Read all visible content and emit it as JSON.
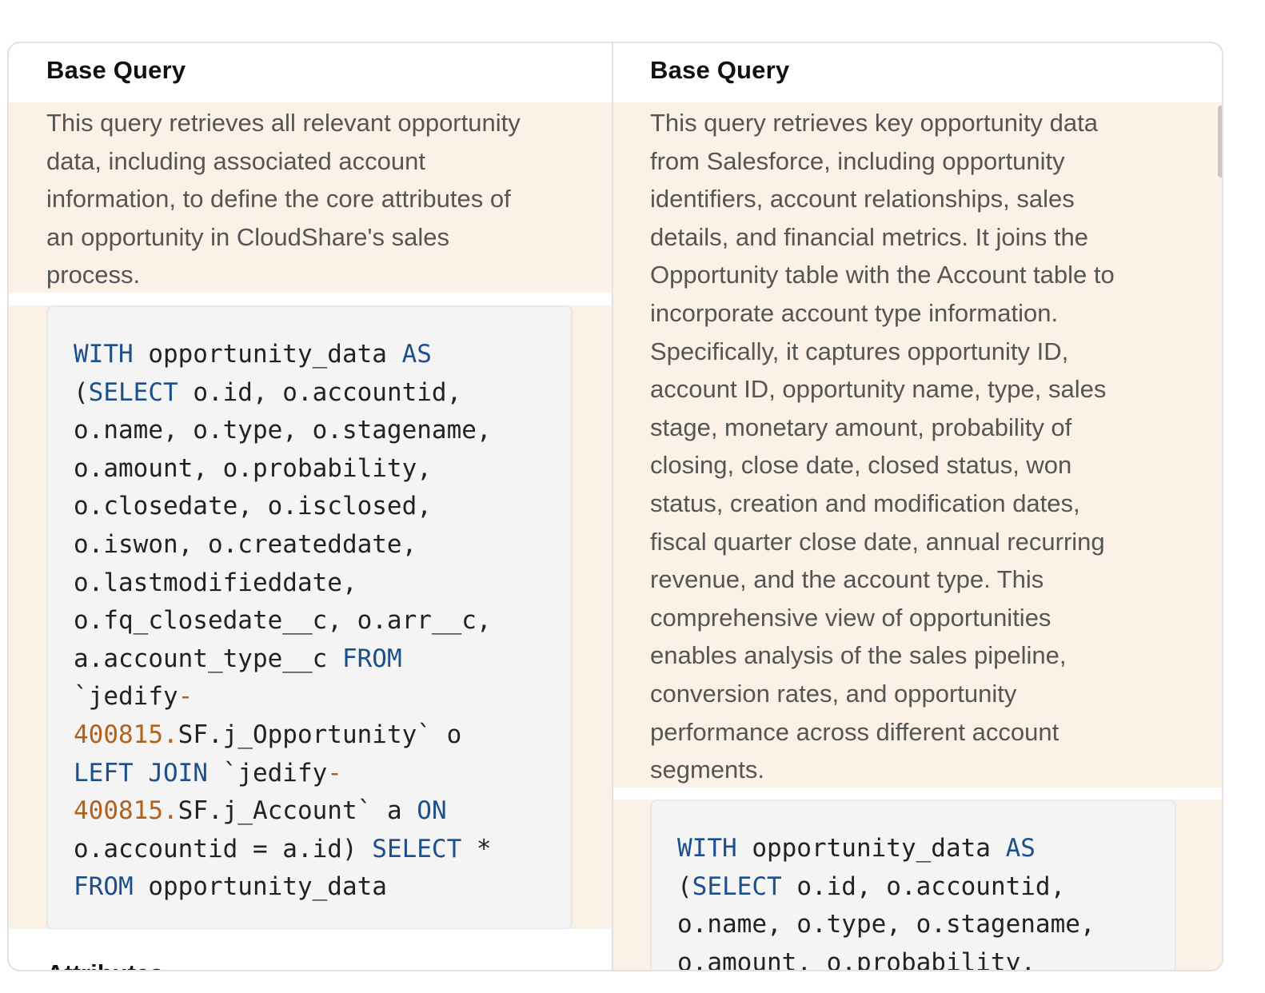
{
  "left": {
    "heading": "Base Query",
    "description_lines": [
      "This query retrieves all relevant opportunity",
      "data, including associated account",
      "information, to define the core attributes of",
      "an opportunity in CloudShare's sales",
      "process."
    ],
    "code_lines": [
      [
        {
          "t": "WITH",
          "k": "kw"
        },
        {
          "t": " opportunity_data "
        },
        {
          "t": "AS",
          "k": "kw"
        }
      ],
      [
        {
          "t": "("
        },
        {
          "t": "SELECT",
          "k": "kw"
        },
        {
          "t": " o.id, o.accountid,"
        }
      ],
      [
        {
          "t": "o.name, o.type, o.stagename,"
        }
      ],
      [
        {
          "t": "o.amount, o.probability,"
        }
      ],
      [
        {
          "t": "o.closedate, o.isclosed,"
        }
      ],
      [
        {
          "t": "o.iswon, o.createddate,"
        }
      ],
      [
        {
          "t": "o.lastmodifieddate,"
        }
      ],
      [
        {
          "t": "o.fq_closedate__c, o.arr__c,"
        }
      ],
      [
        {
          "t": "a.account_type__c "
        },
        {
          "t": "FROM",
          "k": "kw"
        }
      ],
      [
        {
          "t": "`jedify"
        },
        {
          "t": "-",
          "k": "num"
        }
      ],
      [
        {
          "t": "400815.",
          "k": "num"
        },
        {
          "t": "SF.j_Opportunity` o"
        }
      ],
      [
        {
          "t": "LEFT JOIN",
          "k": "kw"
        },
        {
          "t": " `jedify"
        },
        {
          "t": "-",
          "k": "num"
        }
      ],
      [
        {
          "t": "400815.",
          "k": "num"
        },
        {
          "t": "SF.j_Account` a "
        },
        {
          "t": "ON",
          "k": "kw"
        }
      ],
      [
        {
          "t": "o.accountid = a.id) "
        },
        {
          "t": "SELECT",
          "k": "kw"
        },
        {
          "t": " *"
        }
      ],
      [
        {
          "t": "FROM",
          "k": "kw"
        },
        {
          "t": " opportunity_data"
        }
      ]
    ],
    "next_heading": "Attributes"
  },
  "right": {
    "heading": "Base Query",
    "description_lines": [
      "This query retrieves key opportunity data",
      "from Salesforce, including opportunity",
      "identifiers, account relationships, sales",
      "details, and financial metrics. It joins the",
      "Opportunity table with the Account table to",
      "incorporate account type information.",
      "Specifically, it captures opportunity ID,",
      "account ID, opportunity name, type, sales",
      "stage, monetary amount, probability of",
      "closing, close date, closed status, won",
      "status, creation and modification dates,",
      "fiscal quarter close date, annual recurring",
      "revenue, and the account type. This",
      "comprehensive view of opportunities",
      "enables analysis of the sales pipeline,",
      "conversion rates, and opportunity",
      "performance across different account",
      "segments."
    ],
    "code_lines": [
      [
        {
          "t": "WITH",
          "k": "kw"
        },
        {
          "t": " opportunity_data "
        },
        {
          "t": "AS",
          "k": "kw"
        }
      ],
      [
        {
          "t": "("
        },
        {
          "t": "SELECT",
          "k": "kw"
        },
        {
          "t": " o.id, o.accountid,"
        }
      ],
      [
        {
          "t": "o.name, o.type, o.stagename,"
        }
      ],
      [
        {
          "t": "o.amount, o.probability,"
        }
      ]
    ]
  }
}
